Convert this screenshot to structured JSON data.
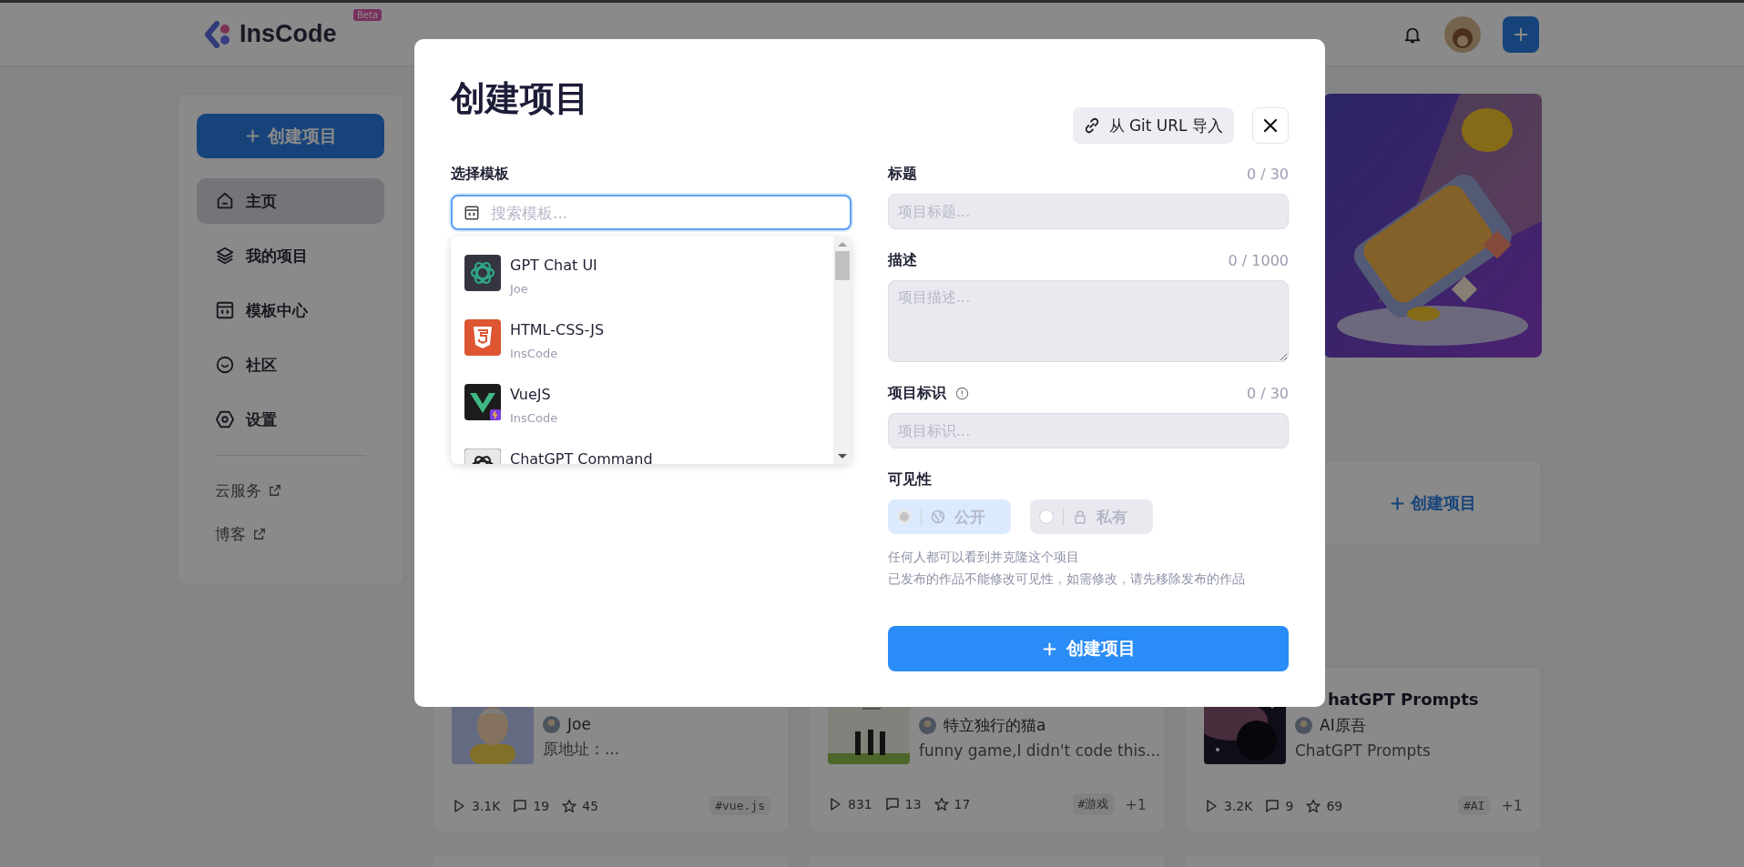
{
  "header": {
    "logo": "InsCode",
    "badge": "Beta"
  },
  "sidebar": {
    "create_button": "创建项目",
    "items": [
      {
        "label": "主页",
        "kind": "home",
        "selected": true
      },
      {
        "label": "我的项目",
        "kind": "layers",
        "selected": false
      },
      {
        "label": "模板中心",
        "kind": "template",
        "selected": false
      },
      {
        "label": "社区",
        "kind": "community",
        "selected": false
      },
      {
        "label": "设置",
        "kind": "settings",
        "selected": false
      }
    ],
    "links": [
      "云服务",
      "博客"
    ]
  },
  "create_card": {
    "label": "创建项目"
  },
  "cards": [
    {
      "author": "Joe",
      "description": "原地址：...",
      "views": "3.1K",
      "comments": "19",
      "stars": "45",
      "tag": "#vue.js"
    },
    {
      "author": "特立独行的猫a",
      "description": "funny game,I didn't code this...",
      "views": "831",
      "comments": "13",
      "stars": "17",
      "tag": "#游戏",
      "extra": "+1"
    },
    {
      "title": "hatGPT Prompts",
      "author": "AI原吾",
      "description": "ChatGPT Prompts",
      "views": "3.2K",
      "comments": "9",
      "stars": "69",
      "tag": "#AI",
      "extra": "+1"
    }
  ],
  "modal": {
    "title": "创建项目",
    "import_button": "从 Git URL 导入",
    "template": {
      "label": "选择模板",
      "placeholder": "搜索模板...",
      "options": [
        {
          "name": "GPT Chat UI",
          "author": "Joe",
          "kind": "gpt-dark"
        },
        {
          "name": "HTML-CSS-JS",
          "author": "InsCode",
          "kind": "html5"
        },
        {
          "name": "VueJS",
          "author": "InsCode",
          "kind": "vue"
        },
        {
          "name": "ChatGPT Command",
          "kind": "gpt-light"
        }
      ]
    },
    "title_field": {
      "label": "标题",
      "counter": "0 / 30",
      "placeholder": "项目标题..."
    },
    "description_field": {
      "label": "描述",
      "counter": "0 / 1000",
      "placeholder": "项目描述..."
    },
    "slug_field": {
      "label": "项目标识",
      "counter": "0 / 30",
      "placeholder": "项目标识..."
    },
    "visibility": {
      "label": "可见性",
      "options": [
        {
          "label": "公开",
          "kind": "public",
          "selected": true
        },
        {
          "label": "私有",
          "kind": "private",
          "selected": false
        }
      ],
      "notes": [
        "任何人都可以看到并克隆这个项目",
        "已发布的作品不能修改可见性，如需修改，请先移除发布的作品"
      ]
    },
    "submit_button": "创建项目"
  }
}
